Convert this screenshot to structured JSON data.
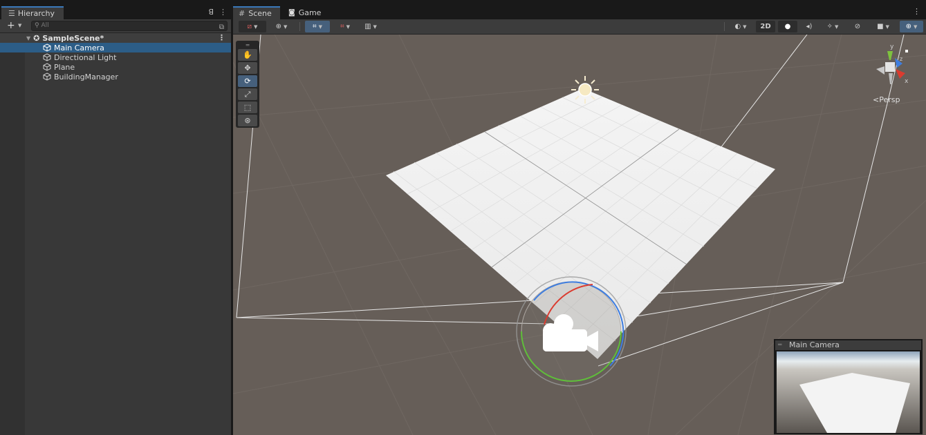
{
  "hierarchy": {
    "tab_label": "Hierarchy",
    "search_placeholder": "All",
    "scene_name": "SampleScene*",
    "items": [
      {
        "label": "Main Camera",
        "selected": true
      },
      {
        "label": "Directional Light",
        "selected": false
      },
      {
        "label": "Plane",
        "selected": false
      },
      {
        "label": "BuildingManager",
        "selected": false
      }
    ]
  },
  "scene_view": {
    "tabs": [
      {
        "label": "Scene",
        "icon": "grid-icon",
        "active": true
      },
      {
        "label": "Game",
        "icon": "gamepad-icon",
        "active": false
      }
    ],
    "toolbar": {
      "mode_2d_label": "2D"
    },
    "tools": [
      "hand-tool-icon",
      "move-tool-icon",
      "rotate-tool-icon",
      "scale-tool-icon",
      "rect-tool-icon",
      "transform-tool-icon"
    ],
    "active_tool": "rotate-tool-icon",
    "projection_label": "Persp",
    "gizmo_axes": {
      "y": "y",
      "z": "z",
      "x": "x"
    },
    "camera_preview_title": "Main Camera"
  },
  "colors": {
    "selection": "#2c5d87",
    "accent": "#3a79bb",
    "viewport_bg": "#665e58",
    "plane": "#efefef",
    "axis_x": "#db3b2f",
    "axis_y": "#7ec33e",
    "axis_z": "#3d7de0"
  }
}
